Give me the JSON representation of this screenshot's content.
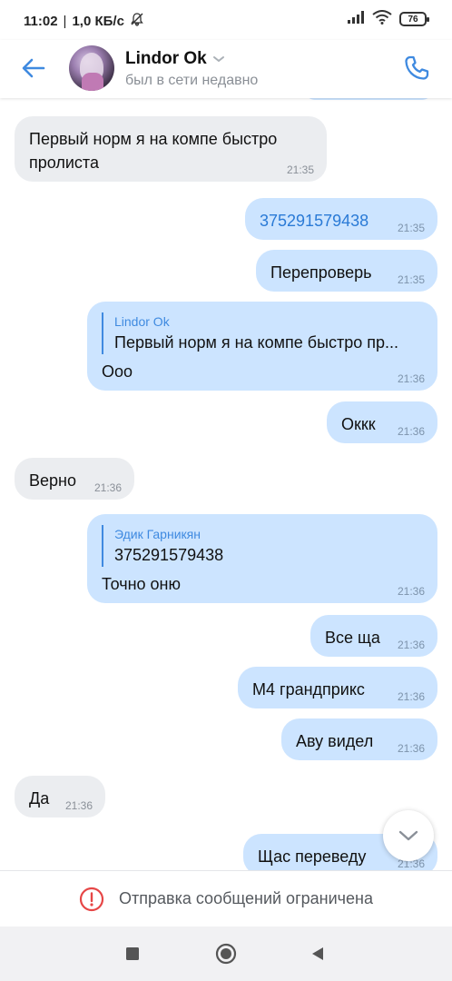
{
  "status_bar": {
    "time": "11:02",
    "speed": "1,0 КБ/с",
    "battery": "76"
  },
  "header": {
    "name": "Lindor Ok",
    "status": "был в сети недавно",
    "icons": {
      "back": "back-arrow-icon",
      "call": "phone-icon",
      "chevron": "chevron-down-icon"
    }
  },
  "messages": [
    {
      "direction": "in",
      "text": "Первый норм я на компе быстро пролиста",
      "time": "21:35"
    },
    {
      "direction": "out",
      "text": "375291579438",
      "time": "21:35",
      "is_link": true
    },
    {
      "direction": "out",
      "text": "Перепроверь",
      "time": "21:35"
    },
    {
      "direction": "out",
      "reply_author": "Lindor Ok",
      "reply_text": "Первый норм я на компе быстро пр...",
      "text": "Ооо",
      "time": "21:36"
    },
    {
      "direction": "out",
      "text": "Оккк",
      "time": "21:36"
    },
    {
      "direction": "in",
      "text": "Верно",
      "time": "21:36"
    },
    {
      "direction": "out",
      "reply_author": "Эдик Гарникян",
      "reply_text": "375291579438",
      "text": "Точно оню",
      "time": "21:36"
    },
    {
      "direction": "out",
      "text": "Все ща",
      "time": "21:36"
    },
    {
      "direction": "out",
      "text": "М4 грандприкс",
      "time": "21:36"
    },
    {
      "direction": "out",
      "text": "Аву видел",
      "time": "21:36"
    },
    {
      "direction": "in",
      "text": "Да",
      "time": "21:36"
    },
    {
      "direction": "out",
      "text": "Щас  переведу",
      "time": "21:36"
    }
  ],
  "restricted": {
    "label": "Отправка сообщений ограничена",
    "icon": "warning-circle-icon",
    "color": "#e64646"
  },
  "colors": {
    "accent": "#3f8ae0",
    "bubble_out": "#cce4ff",
    "bubble_in": "#ebedf0"
  }
}
